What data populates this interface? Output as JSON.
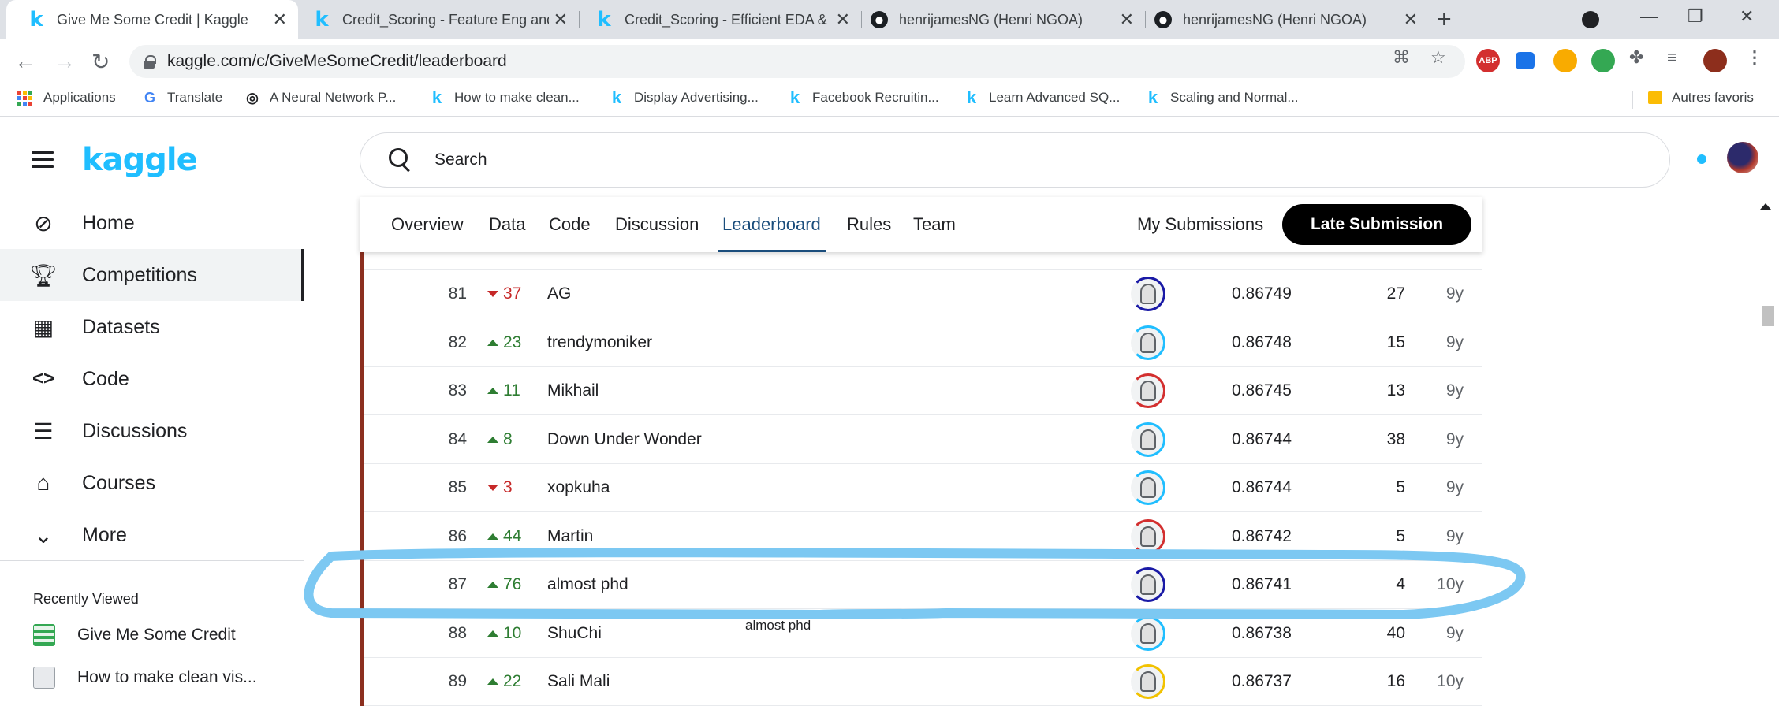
{
  "browser": {
    "tabs": [
      {
        "title": "Give Me Some Credit | Kaggle",
        "icon": "kaggle-icon",
        "active": true
      },
      {
        "title": "Credit_Scoring - Feature Eng and",
        "icon": "kaggle-icon",
        "active": false
      },
      {
        "title": "Credit_Scoring - Efficient EDA & ",
        "icon": "kaggle-icon",
        "active": false
      },
      {
        "title": "henrijamesNG (Henri NGOA)",
        "icon": "github-icon",
        "active": false
      },
      {
        "title": "henrijamesNG (Henri NGOA)",
        "icon": "github-icon",
        "active": false
      }
    ],
    "url": "kaggle.com/c/GiveMeSomeCredit/leaderboard",
    "extensions": {
      "abp": "ABP"
    },
    "bookmarks": [
      {
        "label": "Applications",
        "icon": "apps-grid-icon"
      },
      {
        "label": "Translate",
        "icon": "translate-icon"
      },
      {
        "label": "A Neural Network P...",
        "icon": "neural-network-icon"
      },
      {
        "label": "How to make clean...",
        "icon": "kaggle-icon"
      },
      {
        "label": "Display Advertising...",
        "icon": "kaggle-icon"
      },
      {
        "label": "Facebook Recruitin...",
        "icon": "kaggle-icon"
      },
      {
        "label": "Learn Advanced SQ...",
        "icon": "kaggle-icon"
      },
      {
        "label": "Scaling and Normal...",
        "icon": "kaggle-icon"
      }
    ],
    "other_bookmarks": "Autres favoris"
  },
  "sidebar": {
    "logo": "kaggle",
    "items": [
      {
        "label": "Home",
        "icon": "compass-icon"
      },
      {
        "label": "Competitions",
        "icon": "trophy-icon",
        "active": true
      },
      {
        "label": "Datasets",
        "icon": "table-icon"
      },
      {
        "label": "Code",
        "icon": "code-icon"
      },
      {
        "label": "Discussions",
        "icon": "comments-icon"
      },
      {
        "label": "Courses",
        "icon": "graduation-cap-icon"
      },
      {
        "label": "More",
        "icon": "chevron-down-icon"
      }
    ],
    "recently_viewed_title": "Recently Viewed",
    "recently_viewed": [
      {
        "label": "Give Me Some Credit"
      },
      {
        "label": "How to make clean vis..."
      }
    ]
  },
  "search": {
    "placeholder": "Search"
  },
  "competition_tabs": {
    "tabs": [
      "Overview",
      "Data",
      "Code",
      "Discussion",
      "Leaderboard",
      "Rules",
      "Team"
    ],
    "active": "Leaderboard",
    "my_submissions": "My Submissions",
    "late_submission": "Late Submission"
  },
  "leaderboard": {
    "rows": [
      {
        "rank": "81",
        "direction": "down",
        "delta": "37",
        "team": "AG",
        "score": "0.86749",
        "entries": "27",
        "last": "9y",
        "ring": "#1a1aa6"
      },
      {
        "rank": "82",
        "direction": "up",
        "delta": "23",
        "team": "trendymoniker",
        "score": "0.86748",
        "entries": "15",
        "last": "9y",
        "ring": "#20beff"
      },
      {
        "rank": "83",
        "direction": "up",
        "delta": "11",
        "team": "Mikhail",
        "score": "0.86745",
        "entries": "13",
        "last": "9y",
        "ring": "#d32f2f"
      },
      {
        "rank": "84",
        "direction": "up",
        "delta": "8",
        "team": "Down Under Wonder",
        "score": "0.86744",
        "entries": "38",
        "last": "9y",
        "ring": "#20beff"
      },
      {
        "rank": "85",
        "direction": "down",
        "delta": "3",
        "team": "xopkuha",
        "score": "0.86744",
        "entries": "5",
        "last": "9y",
        "ring": "#20beff"
      },
      {
        "rank": "86",
        "direction": "up",
        "delta": "44",
        "team": "Martin",
        "score": "0.86742",
        "entries": "5",
        "last": "9y",
        "ring": "#d32f2f"
      },
      {
        "rank": "87",
        "direction": "up",
        "delta": "76",
        "team": "almost phd",
        "score": "0.86741",
        "entries": "4",
        "last": "10y",
        "ring": "#1a1aa6"
      },
      {
        "rank": "88",
        "direction": "up",
        "delta": "10",
        "team": "ShuChi",
        "score": "0.86738",
        "entries": "40",
        "last": "9y",
        "ring": "#20beff"
      },
      {
        "rank": "89",
        "direction": "up",
        "delta": "22",
        "team": "Sali Mali",
        "score": "0.86737",
        "entries": "16",
        "last": "10y",
        "ring": "#f2c200"
      }
    ],
    "tooltip": "almost phd",
    "highlight_color": "#7cc8f2"
  }
}
